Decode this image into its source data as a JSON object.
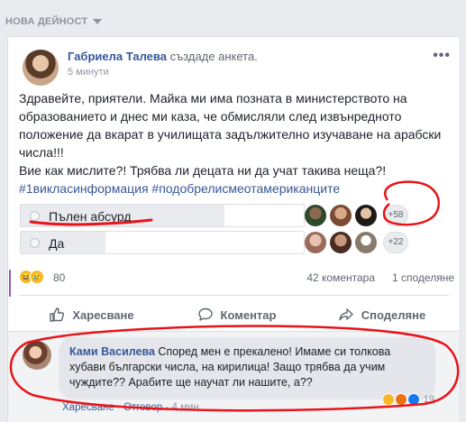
{
  "section": {
    "title": "НОВА ДЕЙНОСТ"
  },
  "post": {
    "author": "Габриела Талева",
    "action": "създаде анкета.",
    "time": "5 минути",
    "text_lines": [
      "Здравейте, приятели. Майка ми има позната в министерството на",
      "образованието и днес ми каза, че обмисляли след извънредното",
      "положение да вкарат в училищата задължително изучаване на арабски",
      "числа!!!",
      "Вие как мислите?! Трябва ли децата ни да учат такива неща?!"
    ],
    "hashtags": "#1викласинформация #подобрелисмеотамериканците"
  },
  "poll": {
    "options": [
      {
        "label": "Пълен абсурд",
        "more_voters": "+58",
        "fill_fraction": 0.72
      },
      {
        "label": "Да",
        "more_voters": "+22",
        "fill_fraction": 0.3
      }
    ]
  },
  "stats": {
    "reactions_count": "80",
    "comments": "42 коментара",
    "shares": "1 споделяне"
  },
  "actions": {
    "like": "Харесване",
    "comment": "Коментар",
    "share": "Споделяне"
  },
  "comment": {
    "author": "Ками Василева",
    "text": " Според мен е прекалено! Имаме си толкова хубави български числа, на кирилица! Защо трябва да учим чуждите?? Арабите ще научат ли нашите, а??",
    "reactions_count": "19",
    "like_link": "Харесване",
    "reply_link": "Отговор",
    "time": "4 мин."
  },
  "colors": {
    "link_blue": "#365899",
    "annotation_red": "#e8141a",
    "background": "#e9ebee"
  }
}
